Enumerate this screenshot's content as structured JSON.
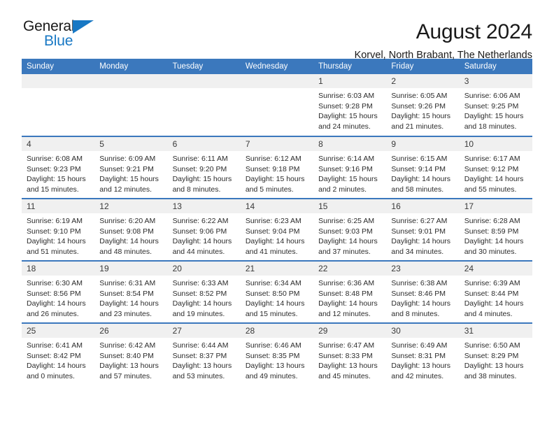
{
  "brand": {
    "line1": "General",
    "line2": "Blue",
    "flag_icon": "triangle-flag-icon",
    "accent_color": "#1878c4"
  },
  "header": {
    "title": "August 2024",
    "subtitle": "Korvel, North Brabant, The Netherlands"
  },
  "theme": {
    "header_bg": "#3b78bd",
    "date_band_bg": "#f0f0f0",
    "row_divider": "#3b78bd"
  },
  "calendar": {
    "weekday_headers": [
      "Sunday",
      "Monday",
      "Tuesday",
      "Wednesday",
      "Thursday",
      "Friday",
      "Saturday"
    ],
    "weeks": [
      [
        {
          "day": "",
          "sunrise": "",
          "sunset": "",
          "daylight1": "",
          "daylight2": ""
        },
        {
          "day": "",
          "sunrise": "",
          "sunset": "",
          "daylight1": "",
          "daylight2": ""
        },
        {
          "day": "",
          "sunrise": "",
          "sunset": "",
          "daylight1": "",
          "daylight2": ""
        },
        {
          "day": "",
          "sunrise": "",
          "sunset": "",
          "daylight1": "",
          "daylight2": ""
        },
        {
          "day": "1",
          "sunrise": "Sunrise: 6:03 AM",
          "sunset": "Sunset: 9:28 PM",
          "daylight1": "Daylight: 15 hours",
          "daylight2": "and 24 minutes."
        },
        {
          "day": "2",
          "sunrise": "Sunrise: 6:05 AM",
          "sunset": "Sunset: 9:26 PM",
          "daylight1": "Daylight: 15 hours",
          "daylight2": "and 21 minutes."
        },
        {
          "day": "3",
          "sunrise": "Sunrise: 6:06 AM",
          "sunset": "Sunset: 9:25 PM",
          "daylight1": "Daylight: 15 hours",
          "daylight2": "and 18 minutes."
        }
      ],
      [
        {
          "day": "4",
          "sunrise": "Sunrise: 6:08 AM",
          "sunset": "Sunset: 9:23 PM",
          "daylight1": "Daylight: 15 hours",
          "daylight2": "and 15 minutes."
        },
        {
          "day": "5",
          "sunrise": "Sunrise: 6:09 AM",
          "sunset": "Sunset: 9:21 PM",
          "daylight1": "Daylight: 15 hours",
          "daylight2": "and 12 minutes."
        },
        {
          "day": "6",
          "sunrise": "Sunrise: 6:11 AM",
          "sunset": "Sunset: 9:20 PM",
          "daylight1": "Daylight: 15 hours",
          "daylight2": "and 8 minutes."
        },
        {
          "day": "7",
          "sunrise": "Sunrise: 6:12 AM",
          "sunset": "Sunset: 9:18 PM",
          "daylight1": "Daylight: 15 hours",
          "daylight2": "and 5 minutes."
        },
        {
          "day": "8",
          "sunrise": "Sunrise: 6:14 AM",
          "sunset": "Sunset: 9:16 PM",
          "daylight1": "Daylight: 15 hours",
          "daylight2": "and 2 minutes."
        },
        {
          "day": "9",
          "sunrise": "Sunrise: 6:15 AM",
          "sunset": "Sunset: 9:14 PM",
          "daylight1": "Daylight: 14 hours",
          "daylight2": "and 58 minutes."
        },
        {
          "day": "10",
          "sunrise": "Sunrise: 6:17 AM",
          "sunset": "Sunset: 9:12 PM",
          "daylight1": "Daylight: 14 hours",
          "daylight2": "and 55 minutes."
        }
      ],
      [
        {
          "day": "11",
          "sunrise": "Sunrise: 6:19 AM",
          "sunset": "Sunset: 9:10 PM",
          "daylight1": "Daylight: 14 hours",
          "daylight2": "and 51 minutes."
        },
        {
          "day": "12",
          "sunrise": "Sunrise: 6:20 AM",
          "sunset": "Sunset: 9:08 PM",
          "daylight1": "Daylight: 14 hours",
          "daylight2": "and 48 minutes."
        },
        {
          "day": "13",
          "sunrise": "Sunrise: 6:22 AM",
          "sunset": "Sunset: 9:06 PM",
          "daylight1": "Daylight: 14 hours",
          "daylight2": "and 44 minutes."
        },
        {
          "day": "14",
          "sunrise": "Sunrise: 6:23 AM",
          "sunset": "Sunset: 9:04 PM",
          "daylight1": "Daylight: 14 hours",
          "daylight2": "and 41 minutes."
        },
        {
          "day": "15",
          "sunrise": "Sunrise: 6:25 AM",
          "sunset": "Sunset: 9:03 PM",
          "daylight1": "Daylight: 14 hours",
          "daylight2": "and 37 minutes."
        },
        {
          "day": "16",
          "sunrise": "Sunrise: 6:27 AM",
          "sunset": "Sunset: 9:01 PM",
          "daylight1": "Daylight: 14 hours",
          "daylight2": "and 34 minutes."
        },
        {
          "day": "17",
          "sunrise": "Sunrise: 6:28 AM",
          "sunset": "Sunset: 8:59 PM",
          "daylight1": "Daylight: 14 hours",
          "daylight2": "and 30 minutes."
        }
      ],
      [
        {
          "day": "18",
          "sunrise": "Sunrise: 6:30 AM",
          "sunset": "Sunset: 8:56 PM",
          "daylight1": "Daylight: 14 hours",
          "daylight2": "and 26 minutes."
        },
        {
          "day": "19",
          "sunrise": "Sunrise: 6:31 AM",
          "sunset": "Sunset: 8:54 PM",
          "daylight1": "Daylight: 14 hours",
          "daylight2": "and 23 minutes."
        },
        {
          "day": "20",
          "sunrise": "Sunrise: 6:33 AM",
          "sunset": "Sunset: 8:52 PM",
          "daylight1": "Daylight: 14 hours",
          "daylight2": "and 19 minutes."
        },
        {
          "day": "21",
          "sunrise": "Sunrise: 6:34 AM",
          "sunset": "Sunset: 8:50 PM",
          "daylight1": "Daylight: 14 hours",
          "daylight2": "and 15 minutes."
        },
        {
          "day": "22",
          "sunrise": "Sunrise: 6:36 AM",
          "sunset": "Sunset: 8:48 PM",
          "daylight1": "Daylight: 14 hours",
          "daylight2": "and 12 minutes."
        },
        {
          "day": "23",
          "sunrise": "Sunrise: 6:38 AM",
          "sunset": "Sunset: 8:46 PM",
          "daylight1": "Daylight: 14 hours",
          "daylight2": "and 8 minutes."
        },
        {
          "day": "24",
          "sunrise": "Sunrise: 6:39 AM",
          "sunset": "Sunset: 8:44 PM",
          "daylight1": "Daylight: 14 hours",
          "daylight2": "and 4 minutes."
        }
      ],
      [
        {
          "day": "25",
          "sunrise": "Sunrise: 6:41 AM",
          "sunset": "Sunset: 8:42 PM",
          "daylight1": "Daylight: 14 hours",
          "daylight2": "and 0 minutes."
        },
        {
          "day": "26",
          "sunrise": "Sunrise: 6:42 AM",
          "sunset": "Sunset: 8:40 PM",
          "daylight1": "Daylight: 13 hours",
          "daylight2": "and 57 minutes."
        },
        {
          "day": "27",
          "sunrise": "Sunrise: 6:44 AM",
          "sunset": "Sunset: 8:37 PM",
          "daylight1": "Daylight: 13 hours",
          "daylight2": "and 53 minutes."
        },
        {
          "day": "28",
          "sunrise": "Sunrise: 6:46 AM",
          "sunset": "Sunset: 8:35 PM",
          "daylight1": "Daylight: 13 hours",
          "daylight2": "and 49 minutes."
        },
        {
          "day": "29",
          "sunrise": "Sunrise: 6:47 AM",
          "sunset": "Sunset: 8:33 PM",
          "daylight1": "Daylight: 13 hours",
          "daylight2": "and 45 minutes."
        },
        {
          "day": "30",
          "sunrise": "Sunrise: 6:49 AM",
          "sunset": "Sunset: 8:31 PM",
          "daylight1": "Daylight: 13 hours",
          "daylight2": "and 42 minutes."
        },
        {
          "day": "31",
          "sunrise": "Sunrise: 6:50 AM",
          "sunset": "Sunset: 8:29 PM",
          "daylight1": "Daylight: 13 hours",
          "daylight2": "and 38 minutes."
        }
      ]
    ]
  }
}
